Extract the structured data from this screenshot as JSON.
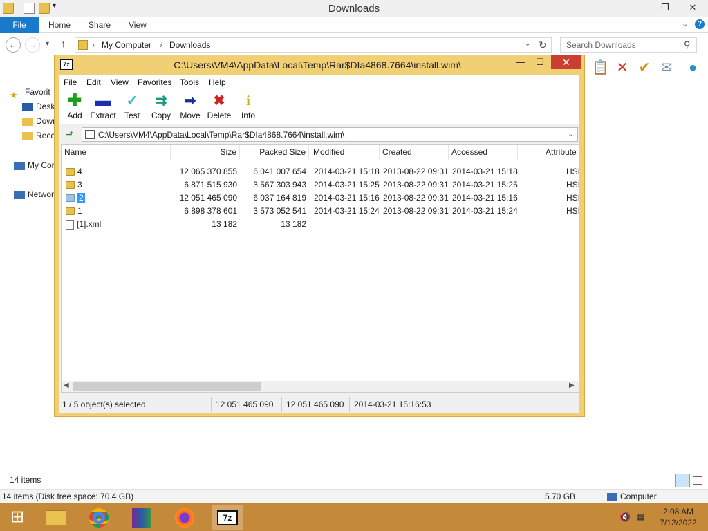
{
  "explorer": {
    "title": "Downloads",
    "ribbon_tabs": [
      "File",
      "Home",
      "Share",
      "View"
    ],
    "breadcrumb": [
      "My Computer",
      "Downloads"
    ],
    "search_placeholder": "Search Downloads",
    "nav_items": [
      "Favorit",
      "Deskt",
      "Down",
      "Recer",
      "My Cor",
      "Networ"
    ],
    "items_count": "14 items",
    "status_left": "14 items (Disk free space: 70.4 GB)",
    "status_size": "5.70 GB",
    "status_location": "Computer"
  },
  "zip": {
    "title": "C:\\Users\\VM4\\AppData\\Local\\Temp\\Rar$DIa4868.7664\\install.wim\\",
    "app_icon": "7z",
    "menu": [
      "File",
      "Edit",
      "View",
      "Favorites",
      "Tools",
      "Help"
    ],
    "tools": [
      {
        "label": "Add",
        "icon": "plus-icon",
        "color": "#1aa01a"
      },
      {
        "label": "Extract",
        "icon": "minus-icon",
        "color": "#1a2fb0"
      },
      {
        "label": "Test",
        "icon": "check-icon",
        "color": "#2bb8c8"
      },
      {
        "label": "Copy",
        "icon": "double-arrow-icon",
        "color": "#1a9a7a"
      },
      {
        "label": "Move",
        "icon": "arrow-right-icon",
        "color": "#1a2f90"
      },
      {
        "label": "Delete",
        "icon": "x-icon",
        "color": "#d02020"
      },
      {
        "label": "Info",
        "icon": "info-icon",
        "color": "#c8b000"
      }
    ],
    "path": "C:\\Users\\VM4\\AppData\\Local\\Temp\\Rar$DIa4868.7664\\install.wim\\",
    "columns": [
      "Name",
      "Size",
      "Packed Size",
      "Modified",
      "Created",
      "Accessed",
      "Attribute"
    ],
    "rows": [
      {
        "name": "4",
        "size": "12 065 370 855",
        "packed": "6 041 007 654",
        "modified": "2014-03-21 15:18",
        "created": "2013-08-22 09:31",
        "accessed": "2014-03-21 15:18",
        "attr": "HSI",
        "type": "folder"
      },
      {
        "name": "3",
        "size": "6 871 515 930",
        "packed": "3 567 303 943",
        "modified": "2014-03-21 15:25",
        "created": "2013-08-22 09:31",
        "accessed": "2014-03-21 15:25",
        "attr": "HSI",
        "type": "folder"
      },
      {
        "name": "2",
        "size": "12 051 465 090",
        "packed": "6 037 164 819",
        "modified": "2014-03-21 15:16",
        "created": "2013-08-22 09:31",
        "accessed": "2014-03-21 15:16",
        "attr": "HSI",
        "type": "folder",
        "selected": true
      },
      {
        "name": "1",
        "size": "6 898 378 601",
        "packed": "3 573 052 541",
        "modified": "2014-03-21 15:24",
        "created": "2013-08-22 09:31",
        "accessed": "2014-03-21 15:24",
        "attr": "HSI",
        "type": "folder"
      },
      {
        "name": "[1].xml",
        "size": "13 182",
        "packed": "13 182",
        "modified": "",
        "created": "",
        "accessed": "",
        "attr": "",
        "type": "file"
      }
    ],
    "status": {
      "selected": "1 / 5 object(s) selected",
      "size": "12 051 465 090",
      "packed": "12 051 465 090",
      "date": "2014-03-21 15:16:53"
    }
  },
  "taskbar": {
    "time": "2:08 AM",
    "date": "7/12/2022",
    "apps": [
      "start-icon",
      "file-explorer-icon",
      "chrome-icon",
      "winrar-icon",
      "firefox-icon",
      "7zip-icon"
    ]
  },
  "colors": {
    "accent": "#1979ca",
    "zip_frame": "#f1cf74",
    "taskbar": "#c48a3a",
    "selection": "#3399ff"
  }
}
